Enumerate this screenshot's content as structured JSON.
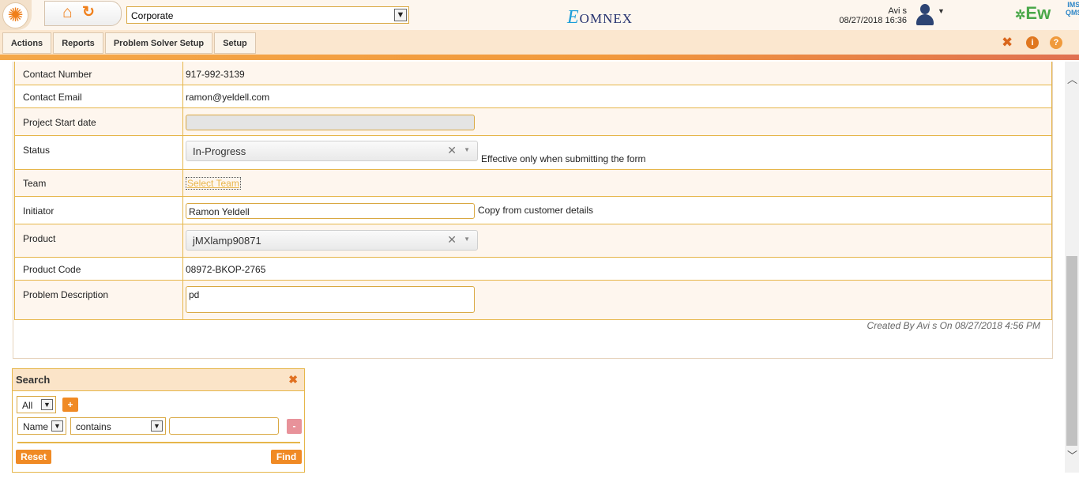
{
  "header": {
    "corporate_value": "Corporate",
    "user_name": "Avi s",
    "datetime": "08/27/2018 16:36",
    "omnex_logo": "OMNEX",
    "ew_logo": "Ew",
    "ims_logo": "IMS",
    "qms_logo": "QMS",
    "icons": [
      "sun-logo-icon",
      "home-icon",
      "refresh-icon",
      "user-avatar-icon",
      "pin-icon",
      "info-icon",
      "help-icon"
    ]
  },
  "menu": {
    "items": [
      "Actions",
      "Reports",
      "Problem Solver Setup",
      "Setup"
    ]
  },
  "form": {
    "rows": [
      {
        "label": "Contact Number",
        "value": "917-992-3139"
      },
      {
        "label": "Contact Email",
        "value": "ramon@yeldell.com"
      },
      {
        "label": "Project Start date",
        "value": ""
      },
      {
        "label": "Status",
        "value": "In-Progress",
        "note": "Effective only when submitting the form"
      },
      {
        "label": "Team",
        "link": "Select Team"
      },
      {
        "label": "Initiator",
        "value": "Ramon Yeldell",
        "note": "Copy from customer details"
      },
      {
        "label": "Product",
        "value": "jMXlamp90871"
      },
      {
        "label": "Product Code",
        "value": "08972-BKOP-2765"
      },
      {
        "label": "Problem Description",
        "value": "pd"
      }
    ],
    "created_by": "Created By Avi s On 08/27/2018 4:56 PM"
  },
  "search": {
    "title": "Search",
    "match_value": "All",
    "add_label": "+",
    "field_value": "Name",
    "operator_value": "contains",
    "text_value": "",
    "remove_label": "-",
    "reset_label": "Reset",
    "find_label": "Find"
  },
  "colors": {
    "accent": "#f08a24",
    "border": "#e6b64a",
    "row_alt": "#fef6ee",
    "menu_bg": "#fbe7cf"
  }
}
